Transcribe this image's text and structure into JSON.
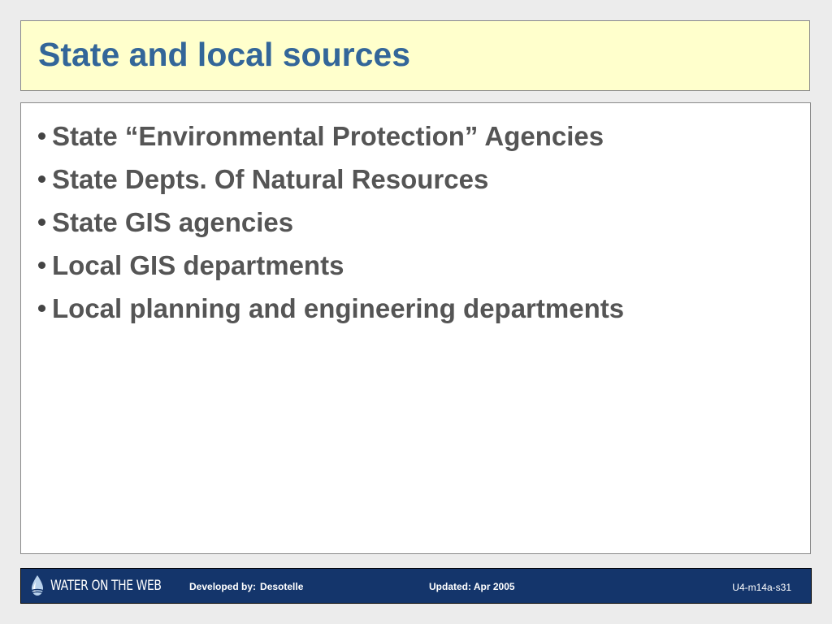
{
  "slide": {
    "title": "State and local sources",
    "bullets": [
      "State “Environmental Protection” Agencies",
      "State Depts. Of Natural Resources",
      "State GIS agencies",
      "Local GIS departments",
      "Local planning and engineering departments"
    ]
  },
  "footer": {
    "logo_text": "WATER ON THE WEB",
    "developed_label": "Developed by:",
    "developer": "Desotelle",
    "updated": "Updated: Apr 2005",
    "slide_id": "U4-m14a-s31"
  },
  "colors": {
    "title": "#336699",
    "title_background": "#ffffcc",
    "footer_background": "#14356b",
    "bullet_text": "#555555"
  }
}
